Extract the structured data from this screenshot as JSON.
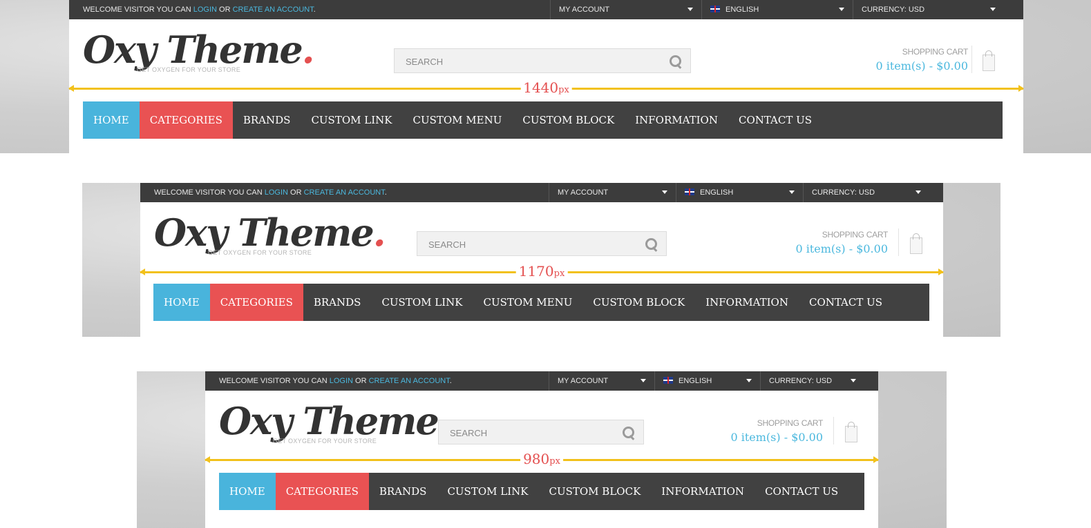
{
  "header": {
    "welcome": "WELCOME VISITOR YOU CAN ",
    "login": "LOGIN",
    "or": " OR ",
    "create_account": "CREATE AN ACCOUNT",
    "period": ".",
    "my_account": "MY ACCOUNT",
    "language": "ENGLISH",
    "currency": "CURRENCY: USD"
  },
  "logo": {
    "name": "Oxy Theme",
    "dot": ".",
    "tagline": "GET OXYGEN FOR YOUR STORE"
  },
  "search": {
    "placeholder": "SEARCH"
  },
  "cart": {
    "label": "SHOPPING CART",
    "value": "0 item(s) - $0.00"
  },
  "nav": {
    "home": "HOME",
    "categories": "CATEGORIES",
    "brands": "BRANDS",
    "custom_link": "CUSTOM LINK",
    "custom_menu": "CUSTOM MENU",
    "custom_block": "CUSTOM BLOCK",
    "information": "INFORMATION",
    "contact_us": "CONTACT US"
  },
  "widths": {
    "w1440": "1440",
    "w1170": "1170",
    "w980": "980",
    "unit": "px"
  },
  "colors": {
    "accent_blue": "#49b4dc",
    "accent_red": "#e95253",
    "nav_dark": "#414141",
    "topbar": "#3c3c3c",
    "measure": "#f2c11b"
  },
  "icons": [
    "search-icon",
    "shopping-bag-icon",
    "uk-flag-icon",
    "dropdown-arrow-icon"
  ]
}
